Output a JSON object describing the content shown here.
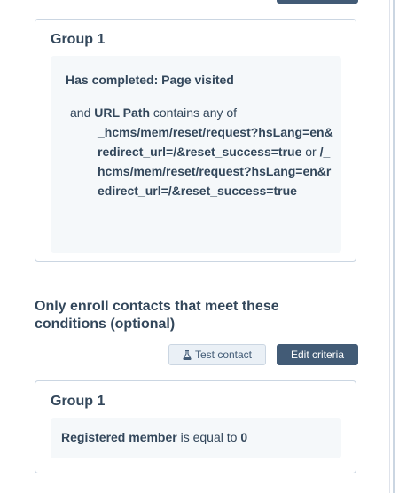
{
  "group1": {
    "title": "Group 1",
    "filter_heading": "Has completed: Page visited",
    "and_word": "and",
    "property": "URL Path",
    "operator": "contains any of",
    "value1": "_hcms/mem/reset/request?hsLang=en&redirect_url=/&reset_success=true",
    "or_word": "or",
    "value2": "/_hcms/mem/reset/request?hsLang=en&redirect_url=/&reset_success=true"
  },
  "enroll_section": {
    "heading": "Only enroll contacts that meet these conditions (optional)",
    "test_contact_label": "Test contact",
    "edit_criteria_label": "Edit criteria"
  },
  "group2": {
    "title": "Group 1",
    "property": "Registered member",
    "operator": "is equal to",
    "value": "0"
  },
  "colors": {
    "primary": "#425b76",
    "text": "#33475b",
    "filter_bg": "#f5f8fa",
    "border": "#cbd6e2"
  },
  "icons": {
    "test_contact": "flask-icon"
  }
}
